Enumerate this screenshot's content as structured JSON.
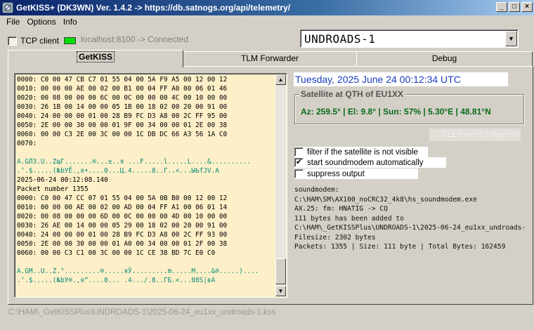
{
  "window": {
    "title": "GetKISS+ (DK3WN) Ver. 1.4.2 -> https://db.satnogs.org/api/telemetry/",
    "controls": [
      "_",
      "□",
      "×"
    ]
  },
  "menu": [
    "File",
    "Options",
    "Info"
  ],
  "connection": {
    "tcp_label": "TCP client",
    "status_text": "localhost:8100 -> Connected",
    "led_color": "#00e000"
  },
  "satellite_select": {
    "value": "UNDROADS-1"
  },
  "tabs": [
    "GetKISS",
    "TLM Forwarder",
    "Debug"
  ],
  "hex_lines": [
    {
      "t": "0000: C0 00 47 CB C7 01 55 04 00 5A F9 A5 00 12 00 12",
      "c": "black"
    },
    {
      "t": "0010: 00 00 00 AE 00 02 00 B1 00 04 FF A0 00 06 01 46",
      "c": "black"
    },
    {
      "t": "0020: 00 08 00 00 00 6C 00 0C 00 00 00 4C 00 10 00 00",
      "c": "black"
    },
    {
      "t": "0030: 26 1B 00 14 00 00 05 1B 00 18 02 00 20 00 91 00",
      "c": "black"
    },
    {
      "t": "0040: 24 00 00 00 01 00 28 B9 FC D3 A8 00 2C FF 95 00",
      "c": "black"
    },
    {
      "t": "0050: 2E 00 00 30 00 00 01 9F 00 34 00 00 01 2E 00 38",
      "c": "black"
    },
    {
      "t": "0060: 00 00 C3 2E 00 3C 00 00 1C DB DC 66 A3 56 1A C0",
      "c": "black"
    },
    {
      "t": "0070:",
      "c": "black"
    },
    {
      "t": "",
      "c": "black"
    },
    {
      "t": "A.GЛЗ.U..ZщГ.......®...±..я ...F.....l.....L....&..........",
      "c": "teal"
    },
    {
      "t": ".‘.$.....(№bУЁ.,я•....0...Ц.4.....8..Г..<...ЫЬfЈV.А",
      "c": "teal"
    },
    {
      "t": "2025-06-24 00:12:08.140",
      "c": "black"
    },
    {
      "t": "Packet number 1355",
      "c": "black"
    },
    {
      "t": "0000: C0 00 47 CC 07 01 55 04 00 5A 0B B0 00 12 00 12",
      "c": "black"
    },
    {
      "t": "0010: 00 00 00 AE 00 02 00 AD 00 04 FF A1 00 06 01 14",
      "c": "black"
    },
    {
      "t": "0020: 00 08 00 00 00 6D 00 0C 00 00 00 4D 00 10 00 00",
      "c": "black"
    },
    {
      "t": "0030: 26 AE 00 14 00 00 05 29 00 18 02 00 20 00 91 00",
      "c": "black"
    },
    {
      "t": "0040: 24 00 00 00 01 00 28 B9 FC D3 A8 00 2C FF 93 00",
      "c": "black"
    },
    {
      "t": "0050: 2E 00 00 30 00 00 01 A0 00 34 00 00 01 2F 00 38",
      "c": "black"
    },
    {
      "t": "0060: 00 00 C3 C1 00 3C 00 00 1C CE 38 BD 7C E0 C0",
      "c": "black"
    },
    {
      "t": "",
      "c": "black"
    },
    {
      "t": "A.GM..U..Z.°.........®.....яЎ.........m.....M....&®.....)....",
      "c": "teal"
    },
    {
      "t": ".‘.$.....(№bУ®.,я“....0... .4.../.8..ГБ.<...08S|вА",
      "c": "teal"
    }
  ],
  "datetime": "Tuesday, 2025 June 24  00:12:34 UTC",
  "satellite_group": {
    "title": "Satellite at QTH of EU1XX",
    "position": "Az: 259.5° | El: 9.8° | Sun: 57% | 5.30°E | 48.81°N"
  },
  "tle_info": "TLE's are 0.1 days old",
  "options": [
    {
      "label": "filter if the satellite is not visible",
      "checked": false
    },
    {
      "label": "start soundmodem automatically",
      "checked": true
    },
    {
      "label": "suppress output",
      "checked": false
    }
  ],
  "log_lines": [
    "soundmodem:",
    "C:\\HAM\\SM\\AX100_noCRC32_4k8\\hs_soundmodem.exe",
    "AX.25: fm: HNATIG -> CQ",
    "111 bytes has been added to",
    "C:\\HAM\\_GetKISSPlus\\UNDROADS-1\\2025-06-24_eu1xx_undroads-1.kss",
    "Filesize: 2302 bytes",
    "Packets: 1355 | Size: 111 byte | Total Bytes: 162459"
  ],
  "status_bar": "C:\\HAM\\_GetKISSPlus\\UNDROADS-1\\2025-06-24_eu1xx_undroads-1.kss"
}
